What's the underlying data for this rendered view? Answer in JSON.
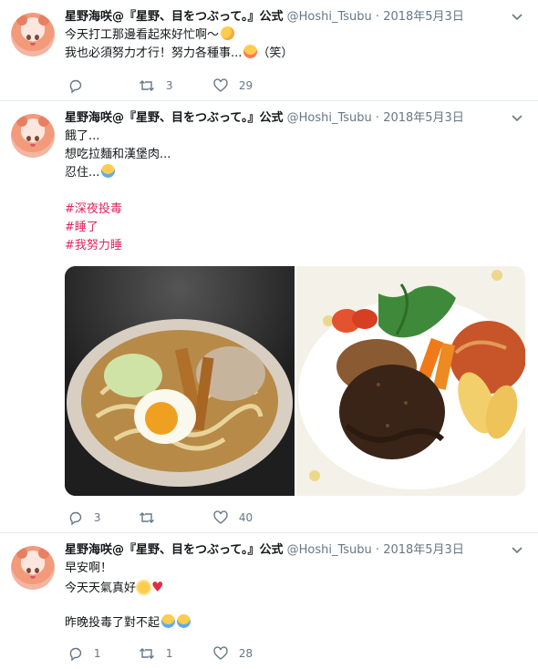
{
  "tweets": [
    {
      "name": "星野海咲@『星野、目をつぶって。』公式",
      "handle": "@Hoshi_Tsubu",
      "separator": "·",
      "date": "2018年5月3日",
      "lines": [
        {
          "text": "今天打工那邊看起來好忙啊～",
          "emoji": "sweat-smile-emoji"
        },
        {
          "text": "我也必須努力才行！努力各種事...",
          "emoji": "yum-emoji",
          "after": "（笑）"
        }
      ],
      "reply_count": "",
      "retweet_count": "3",
      "like_count": "29"
    },
    {
      "name": "星野海咲@『星野、目をつぶって。』公式",
      "handle": "@Hoshi_Tsubu",
      "separator": "·",
      "date": "2018年5月3日",
      "lines": [
        {
          "text": "餓了..."
        },
        {
          "text": "想吃拉麵和漢堡肉..."
        },
        {
          "text": "忍住...",
          "emoji": "crying-emoji"
        }
      ],
      "hashtags": [
        "#深夜投毒",
        "#睡了",
        "#我努力睡"
      ],
      "media": [
        "ramen-photo",
        "hamburg-steak-photo"
      ],
      "reply_count": "3",
      "retweet_count": "",
      "like_count": "40"
    },
    {
      "name": "星野海咲@『星野、目をつぶって。』公式",
      "handle": "@Hoshi_Tsubu",
      "separator": "·",
      "date": "2018年5月3日",
      "lines": [
        {
          "text": "早安啊！"
        },
        {
          "text": "今天天氣真好",
          "emoji": "sun-emoji",
          "emoji2": "heart-emoji"
        },
        {
          "text": ""
        },
        {
          "text": "昨晚投毒了對不起",
          "emoji": "joy-emoji",
          "emoji2": "joy-emoji"
        }
      ],
      "reply_count": "1",
      "retweet_count": "1",
      "like_count": "28"
    }
  ],
  "icons": {
    "reply": "reply-icon",
    "retweet": "retweet-icon",
    "like": "heart-outline-icon",
    "caret": "chevron-down-icon"
  },
  "colors": {
    "hashtag": "#e0245e",
    "secondary_text": "#657786",
    "divider": "#e6ecf0"
  }
}
